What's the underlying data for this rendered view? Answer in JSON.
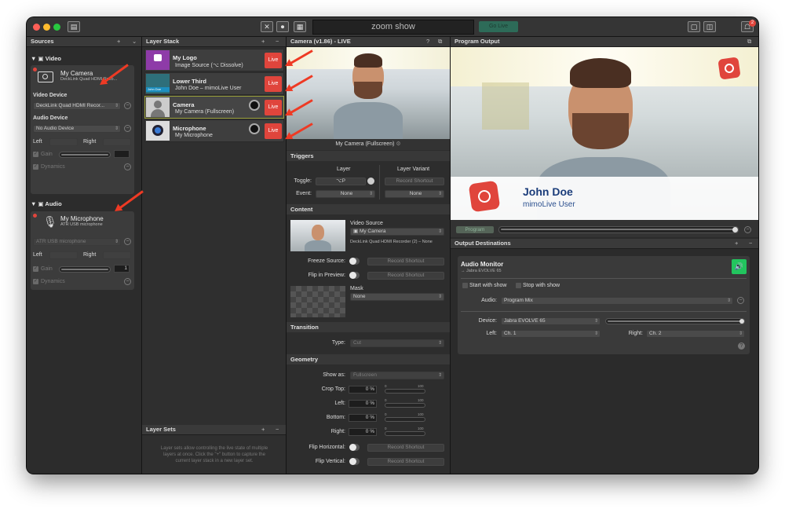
{
  "toolbar": {
    "show_name": "zoom show",
    "go_live": "Go Live",
    "notif_count": "2",
    "close": "✕",
    "record": "⏺",
    "grid": "▦"
  },
  "sources": {
    "title": "Sources",
    "add": "+",
    "video_group": "Video",
    "camera": {
      "name": "My Camera",
      "device": "DeckLink Quad HDMI Reco...",
      "video_device_label": "Video Device",
      "video_device": "DeckLink Quad HDMI Recor...",
      "audio_device_label": "Audio Device",
      "audio_device": "No Audio Device",
      "left": "Left",
      "right": "Right",
      "gain": "Gain",
      "dynamics": "Dynamics"
    },
    "audio_group": "Audio",
    "mic": {
      "name": "My Microphone",
      "device": "ATR USB microphone",
      "audio_device": "ATR USB microphone",
      "left": "Left",
      "right": "Right",
      "gain": "Gain",
      "dynamics": "Dynamics",
      "gain_value": "1"
    }
  },
  "layers": {
    "title": "Layer Stack",
    "add": "+",
    "remove": "−",
    "items": [
      {
        "name": "My Logo",
        "source": "Image Source (⌥ Dissolve)",
        "live": "Live"
      },
      {
        "name": "Lower Third",
        "source": "John Doe – mimoLive User",
        "live": "Live",
        "thumb": "John Doe"
      },
      {
        "name": "Camera",
        "source": "My Camera (Fullscreen)",
        "live": "Live"
      },
      {
        "name": "Microphone",
        "source": "My Microphone",
        "live": "Live"
      }
    ],
    "sets_title": "Layer Sets",
    "sets_add": "+",
    "sets_remove": "−",
    "sets_help": "Layer sets allow controlling the live state of multiple layers at once. Click the \"+\" button to capture the current layer stack in a new layer set."
  },
  "inspector": {
    "title": "Camera (v1.86) - LIVE",
    "help": "?",
    "preview_caption": "My Camera (Fullscreen)",
    "triggers": "Triggers",
    "layer": "Layer",
    "layer_variant": "Layer Variant",
    "toggle_label": "Toggle:",
    "toggle_value": "⌥P",
    "record_shortcut": "Record Shortcut",
    "event_label": "Event:",
    "event_value": "None",
    "variant_value": "None",
    "content": "Content",
    "video_source_label": "Video Source",
    "video_source": "My Camera",
    "video_source_desc": "DeckLink Quad HDMI Recorder (2) – None",
    "freeze_label": "Freeze Source:",
    "flip_preview_label": "Flip in Preview:",
    "mask_label": "Mask",
    "mask_value": "None",
    "transition": "Transition",
    "type_label": "Type:",
    "type_value": "Cut",
    "geometry": "Geometry",
    "show_as_label": "Show as:",
    "show_as_value": "Fullscreen",
    "crop_top": "Crop Top:",
    "left": "Left:",
    "bottom": "Bottom:",
    "right": "Right:",
    "crop_top_v": "0 %",
    "left_v": "0 %",
    "bottom_v": "0 %",
    "right_v": "0 %",
    "range_min": "0",
    "range_max": "100",
    "flip_h": "Flip Horizontal:",
    "flip_v": "Flip Vertical:"
  },
  "program": {
    "title": "Program Output",
    "lower_third_name": "John Doe",
    "lower_third_sub": "mimoLive User",
    "program_label": "Program",
    "dest_title": "Output Destinations",
    "dest_add": "+",
    "dest_remove": "−",
    "monitor": {
      "title": "Audio Monitor",
      "sub": "→ Jabra EVOLVE 65",
      "start_with_show": "Start with show",
      "stop_with_show": "Stop with show",
      "audio_label": "Audio:",
      "audio_value": "Program Mix",
      "device_label": "Device:",
      "device_value": "Jabra EVOLVE 65",
      "left_label": "Left:",
      "left_value": "Ch. 1",
      "right_label": "Right:",
      "right_value": "Ch. 2",
      "help": "?"
    }
  },
  "colors": {
    "live": "#e0453c",
    "golive": "#2d6b58",
    "speaker": "#22c55e",
    "arrow": "#ee3a24"
  }
}
